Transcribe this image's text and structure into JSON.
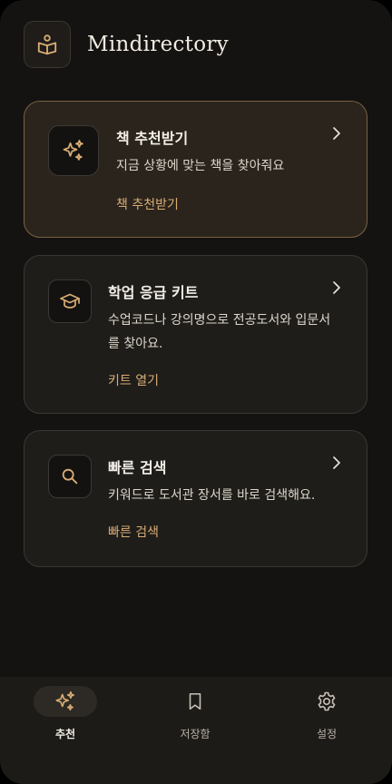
{
  "app": {
    "title": "Mindirectory",
    "logo_icon": "book-user-icon"
  },
  "colors": {
    "accent": "#d9ad75",
    "background": "#151311",
    "card": "#1f1d1a",
    "active_border": "#7a6143"
  },
  "cards": [
    {
      "title": "책 추천받기",
      "description": "지금 상황에 맞는 책을 찾아줘요",
      "link": "책 추천받기",
      "icon": "sparkles-icon"
    },
    {
      "title": "학업 응급 키트",
      "description": "수업코드나 강의명으로 전공도서와 입문서를 찾아요.",
      "link": "키트 열기",
      "icon": "graduation-cap-icon"
    },
    {
      "title": "빠른 검색",
      "description": "키워드로 도서관 장서를 바로 검색해요.",
      "link": "빠른 검색",
      "icon": "search-icon"
    }
  ],
  "tabs": [
    {
      "label": "추천",
      "icon": "sparkles-icon",
      "active": true
    },
    {
      "label": "저장함",
      "icon": "bookmark-icon",
      "active": false
    },
    {
      "label": "설정",
      "icon": "gear-icon",
      "active": false
    }
  ]
}
